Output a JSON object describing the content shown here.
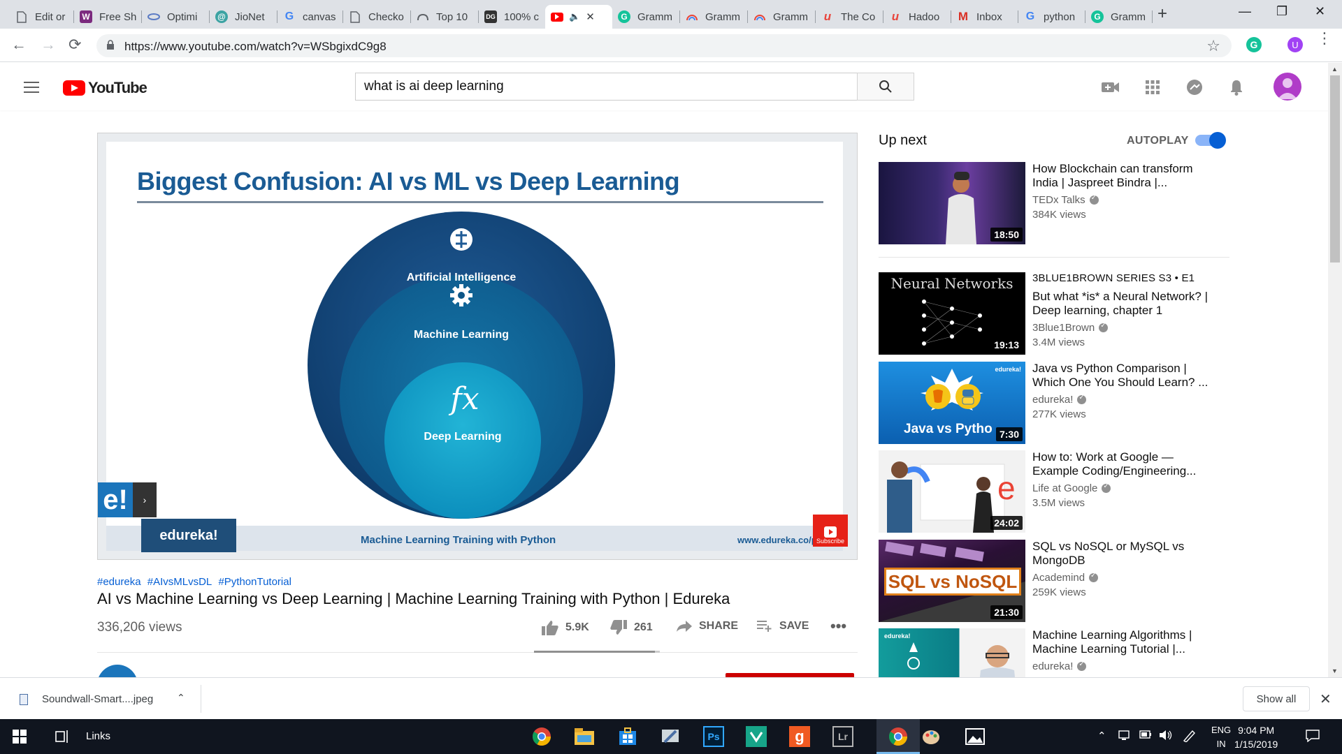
{
  "browser": {
    "tabs": [
      {
        "label": "Edit or",
        "icon": "doc-icon"
      },
      {
        "label": "Free Sh",
        "icon": "w-icon",
        "color": "#7b2a7e"
      },
      {
        "label": "Optimi",
        "icon": "opt-icon"
      },
      {
        "label": "JioNet",
        "icon": "jio-icon"
      },
      {
        "label": "canvas",
        "icon": "google-icon"
      },
      {
        "label": "Checko",
        "icon": "doc-icon"
      },
      {
        "label": "Top 10",
        "icon": "cloud-icon"
      },
      {
        "label": "100% c",
        "icon": "dg-icon"
      },
      {
        "label": "",
        "icon": "youtube-icon",
        "active": true
      },
      {
        "label": "Gramm",
        "icon": "grammarly-icon"
      },
      {
        "label": "Gramm",
        "icon": "rainbow-icon"
      },
      {
        "label": "Gramm",
        "icon": "rainbow-icon"
      },
      {
        "label": "The Co",
        "icon": "u-icon"
      },
      {
        "label": "Hadoo",
        "icon": "u-icon"
      },
      {
        "label": "Inbox",
        "icon": "gmail-icon"
      },
      {
        "label": "python",
        "icon": "google-icon"
      },
      {
        "label": "Gramm",
        "icon": "grammarly-icon"
      }
    ],
    "url": "https://www.youtube.com/watch?v=WSbgixdC9g8",
    "extension_letter": "G",
    "profile_letter": "U"
  },
  "youtube": {
    "logo_text": "YouTube",
    "search_query": "what is ai deep learning"
  },
  "video": {
    "slide": {
      "title": "Biggest Confusion: AI vs ML vs Deep Learning",
      "ring_outer": "Artificial Intelligence",
      "ring_middle": "Machine Learning",
      "ring_inner": "Deep Learning",
      "badge": "edureka!",
      "footer": "Machine Learning Training with Python",
      "footer_url": "www.edureka.co/python",
      "corner_logo": "e!",
      "subscribe_wm": "Subscribe"
    },
    "hashtags": [
      "#edureka",
      "#AIvsMLvsDL",
      "#PythonTutorial"
    ],
    "title": "AI vs Machine Learning vs Deep Learning | Machine Learning Training with Python | Edureka",
    "views": "336,206 views",
    "likes": "5.9K",
    "dislikes": "261",
    "like_ratio": 0.96,
    "share_label": "SHARE",
    "save_label": "SAVE"
  },
  "sidebar": {
    "up_next": "Up next",
    "autoplay": "AUTOPLAY",
    "autoplay_on": true,
    "recommendations": [
      {
        "series": "",
        "title": "How Blockchain can transform India | Jaspreet Bindra |...",
        "channel": "TEDx Talks",
        "verified": true,
        "views": "384K views",
        "duration": "18:50",
        "thumb": "ted-thumb"
      },
      {
        "series": "3BLUE1BROWN SERIES  S3 • E1",
        "title": "But what *is* a Neural Network? | Deep learning, chapter 1",
        "channel": "3Blue1Brown",
        "verified": true,
        "views": "3.4M views",
        "duration": "19:13",
        "thumb": "nn-thumb",
        "thumb_text": "Neural Networks"
      },
      {
        "series": "",
        "title": "Java vs Python Comparison | Which One You Should Learn? ...",
        "channel": "edureka!",
        "verified": true,
        "views": "277K views",
        "duration": "7:30",
        "thumb": "java-thumb",
        "thumb_text": "Java vs Pytho",
        "thumb_badge": "edureka!"
      },
      {
        "series": "",
        "title": "How to: Work at Google — Example Coding/Engineering...",
        "channel": "Life at Google",
        "verified": true,
        "views": "3.5M views",
        "duration": "24:02",
        "thumb": "google-thumb"
      },
      {
        "series": "",
        "title": "SQL vs NoSQL or MySQL vs MongoDB",
        "channel": "Academind",
        "verified": true,
        "views": "259K views",
        "duration": "21:30",
        "thumb": "sql-thumb",
        "thumb_text": "SQL vs NoSQL"
      },
      {
        "series": "",
        "title": "Machine Learning Algorithms | Machine Learning Tutorial |...",
        "channel": "edureka!",
        "verified": true,
        "views": "",
        "duration": "",
        "thumb": "mla-thumb",
        "thumb_badge": "edureka!"
      }
    ]
  },
  "downloads": {
    "file_name": "Soundwall-Smart....jpeg",
    "show_all": "Show all"
  },
  "taskbar": {
    "links": "Links",
    "ps_label": "Ps",
    "lr_label": "Lr",
    "g_label": "g",
    "lang_top": "ENG",
    "lang_bottom": "IN",
    "time": "9:04 PM",
    "date": "1/15/2019"
  }
}
